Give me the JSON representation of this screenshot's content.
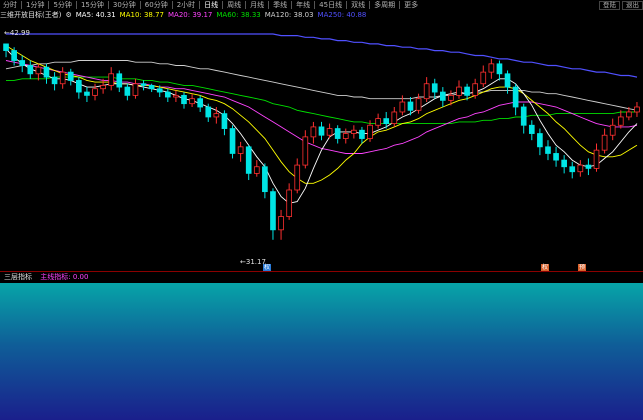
{
  "toolbar": {
    "periods": [
      "分时",
      "1分钟",
      "5分钟",
      "15分钟",
      "30分钟",
      "60分钟",
      "2小时",
      "日线",
      "周线",
      "月线",
      "季线",
      "年线",
      "45日线",
      "双线",
      "多周期",
      "更多"
    ],
    "selected_period": "日线",
    "right_buttons": [
      "登陆",
      "退出"
    ]
  },
  "legend": {
    "indicator": "三维开放目标(王者)",
    "ma5": "MA5: 40.31",
    "ma10": "MA10: 38.77",
    "ma20": "MA20: 39.17",
    "ma60": "MA60: 38.33",
    "ma120": "MA120: 38.03",
    "ma250": "MA250: 40.88",
    "colors": {
      "ma5": "#ffffff",
      "ma10": "#ffff00",
      "ma20": "#ff44ff",
      "ma60": "#00e000",
      "ma120": "#cfcfcf",
      "ma250": "#5050ff"
    }
  },
  "price_labels": {
    "high": "42.99",
    "low": "31.17"
  },
  "sub": {
    "title": "三层指标",
    "value_label": "主线指标: 0.00"
  },
  "markers": [
    "权",
    "预"
  ],
  "chart_data": {
    "type": "candlestick",
    "ylim": [
      29.5,
      44.2
    ],
    "candles": [
      [
        43.0,
        42.6,
        43.0,
        42.2
      ],
      [
        42.6,
        42.0,
        42.8,
        41.7
      ],
      [
        42.0,
        41.7,
        42.3,
        41.3
      ],
      [
        41.7,
        41.2,
        42.0,
        40.9
      ],
      [
        41.2,
        41.6,
        41.8,
        40.8
      ],
      [
        41.6,
        41.0,
        41.8,
        40.6
      ],
      [
        41.0,
        40.6,
        41.3,
        40.2
      ],
      [
        40.6,
        41.3,
        41.6,
        40.3
      ],
      [
        41.3,
        40.8,
        41.5,
        40.5
      ],
      [
        40.8,
        40.1,
        41.0,
        39.7
      ],
      [
        40.1,
        39.9,
        40.4,
        39.5
      ],
      [
        39.9,
        40.3,
        40.6,
        39.6
      ],
      [
        40.3,
        40.5,
        40.9,
        40.0
      ],
      [
        40.5,
        41.2,
        41.6,
        40.2
      ],
      [
        41.2,
        40.4,
        41.4,
        40.1
      ],
      [
        40.4,
        39.9,
        40.6,
        39.6
      ],
      [
        39.9,
        40.6,
        40.9,
        39.7
      ],
      [
        40.6,
        40.5,
        40.8,
        40.2
      ],
      [
        40.5,
        40.3,
        40.6,
        40.1
      ],
      [
        40.3,
        40.1,
        40.5,
        39.8
      ],
      [
        40.1,
        39.8,
        40.3,
        39.5
      ],
      [
        39.8,
        39.9,
        40.2,
        39.5
      ],
      [
        39.9,
        39.4,
        40.1,
        39.1
      ],
      [
        39.4,
        39.7,
        40.0,
        39.2
      ],
      [
        39.7,
        39.2,
        39.9,
        38.9
      ],
      [
        39.2,
        38.6,
        39.4,
        38.3
      ],
      [
        38.6,
        38.8,
        39.2,
        38.2
      ],
      [
        38.8,
        37.9,
        39.0,
        37.5
      ],
      [
        37.9,
        36.4,
        38.1,
        36.1
      ],
      [
        36.4,
        36.8,
        37.1,
        35.9
      ],
      [
        36.8,
        35.2,
        36.9,
        34.8
      ],
      [
        35.2,
        35.6,
        36.0,
        35.0
      ],
      [
        35.6,
        34.1,
        35.8,
        33.7
      ],
      [
        34.1,
        31.8,
        34.3,
        31.2
      ],
      [
        31.8,
        32.6,
        33.0,
        31.2
      ],
      [
        32.6,
        34.2,
        34.6,
        32.4
      ],
      [
        34.2,
        35.7,
        36.1,
        34.0
      ],
      [
        35.7,
        37.4,
        37.8,
        35.5
      ],
      [
        37.4,
        38.0,
        38.3,
        37.0
      ],
      [
        38.0,
        37.5,
        38.3,
        37.2
      ],
      [
        37.5,
        37.9,
        38.2,
        37.3
      ],
      [
        37.9,
        37.3,
        38.1,
        37.0
      ],
      [
        37.3,
        37.6,
        37.9,
        37.0
      ],
      [
        37.6,
        37.8,
        38.1,
        37.3
      ],
      [
        37.8,
        37.3,
        38.0,
        37.0
      ],
      [
        37.3,
        38.1,
        38.4,
        37.1
      ],
      [
        38.1,
        38.5,
        38.8,
        37.9
      ],
      [
        38.5,
        38.2,
        38.9,
        37.9
      ],
      [
        38.2,
        38.9,
        39.2,
        38.0
      ],
      [
        38.9,
        39.5,
        39.9,
        38.7
      ],
      [
        39.5,
        39.0,
        39.8,
        38.7
      ],
      [
        39.0,
        39.7,
        40.0,
        38.8
      ],
      [
        39.7,
        40.6,
        41.0,
        39.5
      ],
      [
        40.6,
        40.1,
        40.9,
        39.7
      ],
      [
        40.1,
        39.6,
        40.4,
        39.2
      ],
      [
        39.6,
        39.9,
        40.2,
        39.3
      ],
      [
        39.9,
        40.4,
        40.8,
        39.7
      ],
      [
        40.4,
        39.9,
        40.6,
        39.6
      ],
      [
        39.9,
        40.6,
        40.9,
        39.7
      ],
      [
        40.6,
        41.3,
        41.7,
        40.4
      ],
      [
        41.3,
        41.8,
        42.1,
        40.9
      ],
      [
        41.8,
        41.2,
        42.0,
        40.8
      ],
      [
        41.2,
        40.4,
        41.4,
        40.0
      ],
      [
        40.4,
        39.2,
        40.6,
        38.7
      ],
      [
        39.2,
        38.1,
        39.4,
        37.6
      ],
      [
        38.1,
        37.6,
        38.4,
        37.2
      ],
      [
        37.6,
        36.8,
        37.9,
        36.3
      ],
      [
        36.8,
        36.4,
        37.2,
        36.0
      ],
      [
        36.4,
        36.0,
        36.8,
        35.6
      ],
      [
        36.0,
        35.6,
        36.3,
        35.2
      ],
      [
        35.6,
        35.3,
        35.9,
        34.9
      ],
      [
        35.3,
        35.7,
        36.0,
        35.0
      ],
      [
        35.7,
        35.5,
        36.1,
        35.1
      ],
      [
        35.5,
        36.6,
        37.0,
        35.3
      ],
      [
        36.6,
        37.5,
        37.9,
        36.4
      ],
      [
        37.5,
        38.1,
        38.5,
        37.2
      ],
      [
        38.1,
        38.6,
        39.0,
        37.9
      ],
      [
        38.6,
        38.9,
        39.2,
        38.4
      ],
      [
        38.9,
        39.2,
        39.5,
        38.6
      ]
    ],
    "ma5": [
      42.7,
      42.2,
      41.8,
      41.5,
      41.3,
      41.1,
      40.9,
      40.9,
      40.8,
      40.6,
      40.4,
      40.4,
      40.5,
      40.6,
      40.6,
      40.6,
      40.5,
      40.4,
      40.3,
      40.2,
      40.1,
      39.9,
      39.7,
      39.6,
      39.4,
      39.2,
      39.0,
      38.7,
      38.2,
      37.6,
      36.9,
      36.2,
      35.6,
      34.6,
      33.8,
      33.4,
      33.5,
      34.3,
      35.5,
      36.6,
      37.4,
      37.7,
      37.7,
      37.7,
      37.6,
      37.6,
      37.8,
      38.0,
      38.3,
      38.6,
      38.8,
      39.1,
      39.4,
      39.7,
      39.9,
      40.0,
      40.1,
      40.0,
      40.1,
      40.3,
      40.6,
      40.9,
      40.9,
      40.6,
      40.0,
      39.3,
      38.4,
      37.6,
      36.9,
      36.5,
      36.0,
      35.7,
      35.6,
      35.7,
      36.1,
      36.5,
      37.1,
      37.7,
      38.2
    ],
    "ma10": [
      42.9,
      42.6,
      42.3,
      42.0,
      41.8,
      41.6,
      41.4,
      41.2,
      41.1,
      41.0,
      40.8,
      40.7,
      40.7,
      40.7,
      40.6,
      40.6,
      40.5,
      40.5,
      40.5,
      40.4,
      40.3,
      40.2,
      40.1,
      40.0,
      39.9,
      39.7,
      39.6,
      39.4,
      39.1,
      38.7,
      38.3,
      37.8,
      37.3,
      36.6,
      35.9,
      35.3,
      34.9,
      34.6,
      34.6,
      34.8,
      35.1,
      35.5,
      36.0,
      36.4,
      37.0,
      37.4,
      37.7,
      37.8,
      38.0,
      38.2,
      38.3,
      38.5,
      38.8,
      39.0,
      39.2,
      39.4,
      39.6,
      39.7,
      39.9,
      40.1,
      40.3,
      40.4,
      40.4,
      40.3,
      40.0,
      39.6,
      39.2,
      38.8,
      38.3,
      37.9,
      37.4,
      36.9,
      36.5,
      36.3,
      36.2,
      36.2,
      36.3,
      36.6,
      36.9
    ],
    "ma20": [
      42.0,
      41.9,
      41.8,
      41.7,
      41.6,
      41.5,
      41.4,
      41.3,
      41.2,
      41.1,
      41.0,
      40.9,
      40.8,
      40.8,
      40.7,
      40.7,
      40.6,
      40.6,
      40.5,
      40.4,
      40.4,
      40.3,
      40.3,
      40.2,
      40.1,
      40.0,
      39.9,
      39.8,
      39.6,
      39.4,
      39.2,
      38.9,
      38.6,
      38.3,
      38.0,
      37.7,
      37.4,
      37.1,
      36.9,
      36.7,
      36.6,
      36.5,
      36.4,
      36.4,
      36.4,
      36.5,
      36.6,
      36.7,
      36.9,
      37.0,
      37.2,
      37.4,
      37.7,
      37.9,
      38.1,
      38.3,
      38.5,
      38.6,
      38.8,
      38.9,
      39.1,
      39.3,
      39.4,
      39.5,
      39.5,
      39.5,
      39.4,
      39.3,
      39.2,
      39.0,
      38.8,
      38.6,
      38.4,
      38.2,
      38.1,
      38.0,
      38.0,
      38.0,
      38.1
    ],
    "ma60": [
      40.8,
      40.8,
      40.9,
      40.9,
      40.9,
      40.9,
      41.0,
      41.0,
      41.0,
      41.0,
      41.0,
      41.0,
      41.0,
      41.0,
      40.9,
      40.9,
      40.9,
      40.8,
      40.8,
      40.7,
      40.7,
      40.6,
      40.5,
      40.5,
      40.4,
      40.3,
      40.2,
      40.1,
      40.0,
      39.9,
      39.8,
      39.7,
      39.6,
      39.4,
      39.3,
      39.2,
      39.0,
      38.9,
      38.8,
      38.7,
      38.6,
      38.5,
      38.4,
      38.3,
      38.3,
      38.2,
      38.2,
      38.2,
      38.2,
      38.2,
      38.2,
      38.2,
      38.2,
      38.2,
      38.2,
      38.2,
      38.3,
      38.3,
      38.3,
      38.4,
      38.4,
      38.5,
      38.5,
      38.6,
      38.6,
      38.7,
      38.7,
      38.7,
      38.8,
      38.8,
      38.8,
      38.8,
      38.8,
      38.8,
      38.8,
      38.8,
      38.9,
      38.9,
      38.9
    ],
    "ma120": [
      41.5,
      41.6,
      41.7,
      41.7,
      41.8,
      41.8,
      41.9,
      41.9,
      41.9,
      42.0,
      42.0,
      42.0,
      42.0,
      42.0,
      42.0,
      42.0,
      41.9,
      41.9,
      41.9,
      41.8,
      41.8,
      41.7,
      41.7,
      41.6,
      41.5,
      41.5,
      41.4,
      41.3,
      41.2,
      41.1,
      41.0,
      40.9,
      40.8,
      40.7,
      40.6,
      40.5,
      40.4,
      40.3,
      40.2,
      40.1,
      40.0,
      39.9,
      39.9,
      39.8,
      39.8,
      39.7,
      39.7,
      39.7,
      39.7,
      39.7,
      39.7,
      39.8,
      39.8,
      39.8,
      39.9,
      39.9,
      40.0,
      40.0,
      40.1,
      40.1,
      40.2,
      40.2,
      40.2,
      40.2,
      40.2,
      40.1,
      40.1,
      40.0,
      40.0,
      39.9,
      39.8,
      39.7,
      39.6,
      39.5,
      39.4,
      39.3,
      39.2,
      39.1,
      39.0
    ],
    "ma250": [
      43.6,
      43.6,
      43.6,
      43.6,
      43.6,
      43.6,
      43.6,
      43.6,
      43.6,
      43.6,
      43.6,
      43.6,
      43.6,
      43.6,
      43.6,
      43.6,
      43.6,
      43.6,
      43.6,
      43.6,
      43.6,
      43.6,
      43.6,
      43.6,
      43.6,
      43.6,
      43.6,
      43.6,
      43.6,
      43.6,
      43.6,
      43.6,
      43.6,
      43.6,
      43.5,
      43.5,
      43.5,
      43.4,
      43.4,
      43.3,
      43.3,
      43.2,
      43.2,
      43.1,
      43.1,
      43.0,
      43.0,
      42.9,
      42.9,
      42.8,
      42.8,
      42.7,
      42.7,
      42.6,
      42.6,
      42.5,
      42.5,
      42.4,
      42.3,
      42.3,
      42.2,
      42.1,
      42.1,
      42.0,
      41.9,
      41.9,
      41.8,
      41.7,
      41.7,
      41.6,
      41.5,
      41.5,
      41.4,
      41.3,
      41.3,
      41.2,
      41.1,
      41.1,
      41.0
    ]
  }
}
